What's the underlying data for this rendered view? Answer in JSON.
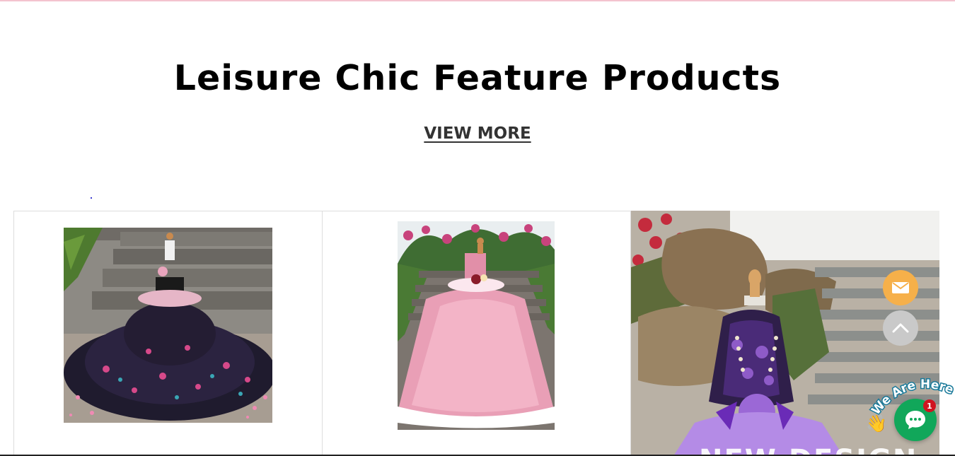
{
  "section": {
    "title": "Leisure Chic Feature Products",
    "view_more_label": "VIEW MORE"
  },
  "products": [
    {
      "image_icon": "black-floral-pet-gown-image"
    },
    {
      "image_icon": "pink-rose-ruffle-pet-gown-image"
    },
    {
      "image_icon": "purple-lace-pet-gown-image",
      "overlay_text": "NEW DESIGN"
    }
  ],
  "widgets": {
    "mail_icon": "envelope-icon",
    "top_icon": "chevron-up-icon",
    "chat_icon": "chat-bubble-icon",
    "chat_badge_count": "1",
    "chat_tagline": "We Are Here!",
    "hand_icon": "waving-hand-icon"
  },
  "colors": {
    "top_rule": "#f4c3cf",
    "mail_button": "#f6b04a",
    "top_button": "#c9c9c9",
    "chat_button": "#11a75a",
    "badge": "#d0141f"
  }
}
